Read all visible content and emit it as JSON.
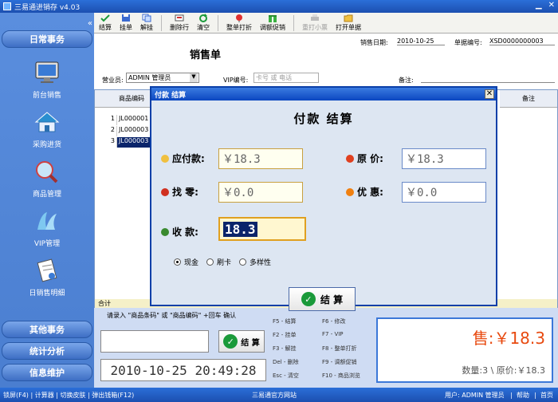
{
  "window": {
    "title": "三易通进销存 v4.03"
  },
  "sidebar": {
    "categories": [
      "日常事务",
      "其他事务",
      "统计分析",
      "信息维护"
    ],
    "items": [
      {
        "label": "前台销售",
        "icon": "monitor-icon"
      },
      {
        "label": "采购进货",
        "icon": "house-icon"
      },
      {
        "label": "商品管理",
        "icon": "magnifier-icon"
      },
      {
        "label": "VIP管理",
        "icon": "people-icon"
      },
      {
        "label": "日销售明细",
        "icon": "document-icon"
      }
    ]
  },
  "toolbar": {
    "buttons": [
      "结算",
      "挂单",
      "解挂",
      "删除行",
      "清空",
      "整单打折",
      "调额促销",
      "重打小票",
      "打开单据"
    ]
  },
  "form": {
    "title": "销售单",
    "sale_date_label": "销售日期:",
    "sale_date": "2010-10-25",
    "doc_no_label": "单据编号:",
    "doc_no": "XSD0000000003",
    "salesperson_label": "营业员:",
    "salesperson": "ADMIN 管理员",
    "vip_label": "VIP编号:",
    "vip_placeholder": "卡号 或 电话",
    "note_label": "备注:"
  },
  "grid": {
    "code_header": "商品编码",
    "note_header": "备注",
    "rows": [
      {
        "num": "1",
        "code": "JL000001"
      },
      {
        "num": "2",
        "code": "JL000003"
      },
      {
        "num": "3",
        "code": "JL000003"
      }
    ],
    "total_label": "合计"
  },
  "dialog": {
    "title": "付款 结算",
    "heading": "付款  结算",
    "payable_label": "应付款:",
    "payable": "￥18.3",
    "original_label": "原  价:",
    "original": "￥18.3",
    "change_label": "找  零:",
    "change": "￥0.0",
    "discount_label": "优  惠:",
    "discount": "￥0.0",
    "received_label": "收  款:",
    "received": "18.3",
    "methods": [
      "现金",
      "刷卡",
      "多样性"
    ],
    "settle_label": "结  算"
  },
  "bottom": {
    "hint": "请录入 \"商品条码\" 或 \"商品编码\"  +回车 确认",
    "settle_label": "结 算",
    "datetime": "2010-10-25 20:49:28",
    "shortcuts": [
      [
        "F5 - 结算",
        "F6 - 修改"
      ],
      [
        "F2 - 挂单",
        "F7 - VIP"
      ],
      [
        "F3 - 解挂",
        "F8 - 整单打折"
      ],
      [
        "Del - 删除",
        "F9 - 调额促销"
      ],
      [
        "Esc - 清空",
        "F10 - 商品浏览"
      ]
    ],
    "sale_total": "售:￥18.3",
    "summary": "数量:3 \\ 原价:￥18.3"
  },
  "statusbar": {
    "items": [
      "锁屏(F4)",
      "计算器",
      "切换皮肤",
      "弹出钱箱(F12)"
    ],
    "site": "三易通官方网站",
    "user": "用户: ADMIN 管理员",
    "help": "帮助",
    "home": "首页"
  }
}
